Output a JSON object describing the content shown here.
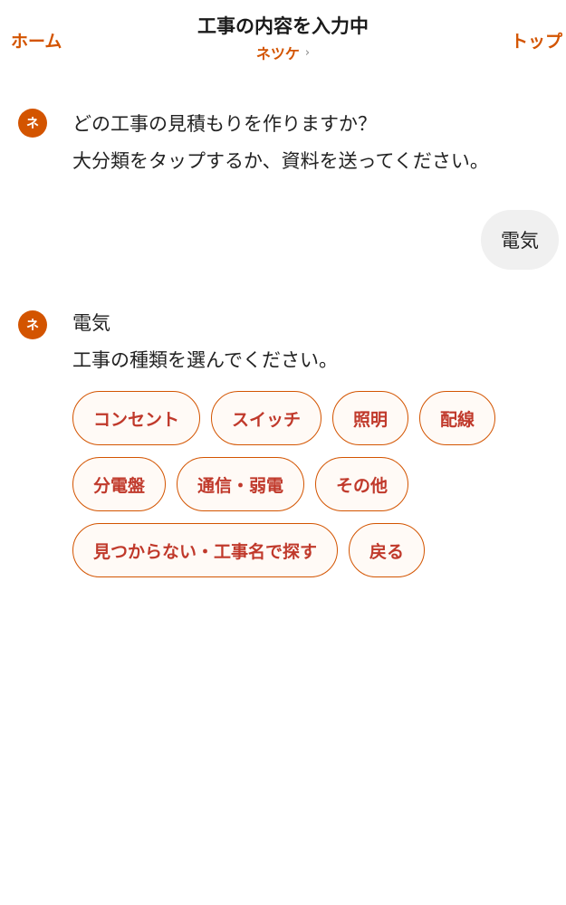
{
  "header": {
    "home_label": "ホーム",
    "top_label": "トップ",
    "title": "工事の内容を入力中",
    "subtitle": "ネツケ",
    "subtitle_chevron": "›"
  },
  "messages": {
    "bot1": {
      "avatar": "ネ",
      "line1": "どの工事の見積もりを作りますか？",
      "line2": "大分類をタップするか、資料を送ってください。"
    },
    "user1": {
      "text": "電気"
    },
    "bot2": {
      "avatar": "ネ",
      "line1": "電気",
      "line2": "工事の種類を選んでください。"
    }
  },
  "chips": [
    [
      "コンセント",
      "スイッチ",
      "照明",
      "配線"
    ],
    [
      "分電盤",
      "通信・弱電",
      "その他"
    ],
    [
      "見つからない・工事名で探す",
      "戻る"
    ]
  ],
  "colors": {
    "accent": "#d35400",
    "chip_text": "#c0392b",
    "bubble": "#f0f0f0"
  }
}
